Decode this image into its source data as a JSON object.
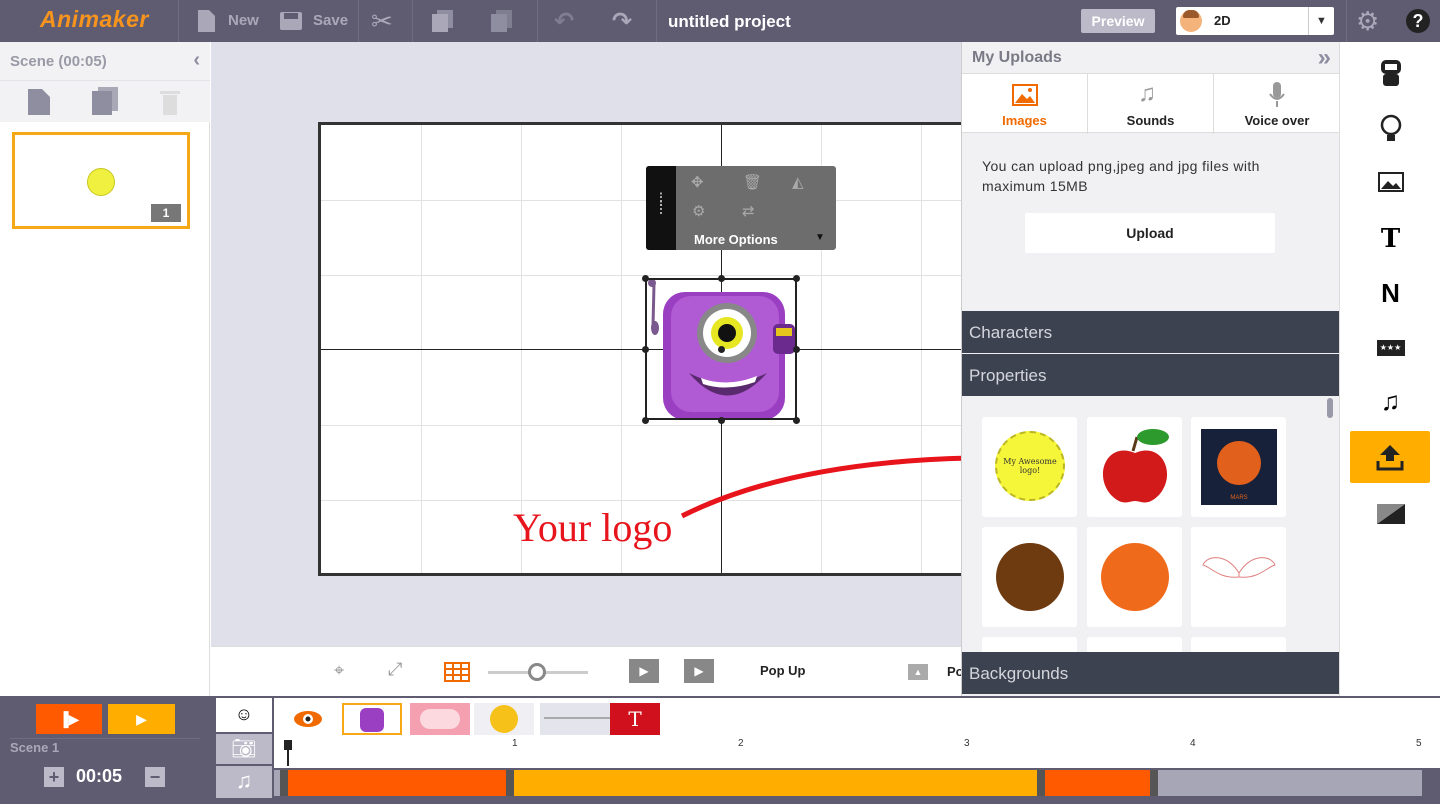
{
  "app": {
    "name": "Animaker",
    "project_title": "untitled project"
  },
  "toolbar": {
    "new_label": "New",
    "save_label": "Save",
    "preview_label": "Preview",
    "mode_value": "2D"
  },
  "scenes": {
    "title": "Scene  (00:05)",
    "thumb_number": "1"
  },
  "canvas": {
    "annotation": "Your logo"
  },
  "object_menu": {
    "more_label": "More Options"
  },
  "stage_tools": {
    "animation_label": "Pop Up",
    "animation_label2": "Po"
  },
  "panel": {
    "title": "My Uploads",
    "tabs": [
      {
        "label": "Images",
        "icon": "image-icon"
      },
      {
        "label": "Sounds",
        "icon": "music-note-icon"
      },
      {
        "label": "Voice over",
        "icon": "microphone-icon"
      }
    ],
    "info": "You can upload png,jpeg and jpg files with maximum 15MB",
    "upload_label": "Upload",
    "sections": {
      "characters": "Characters",
      "properties": "Properties",
      "backgrounds": "Backgrounds"
    },
    "tiles": [
      {
        "name": "logo-tile",
        "text": "My Awesome logo!"
      },
      {
        "name": "apple-tile"
      },
      {
        "name": "mars-tile",
        "text": "MARS"
      },
      {
        "name": "brown-planet-tile"
      },
      {
        "name": "orange-planet-tile"
      },
      {
        "name": "wings-tile"
      }
    ]
  },
  "rail": {
    "items": [
      "character-icon",
      "bulb-icon",
      "image-icon",
      "text-icon",
      "n-icon",
      "rating-icon",
      "music-icon",
      "upload-icon",
      "background-icon"
    ],
    "active": "upload-icon"
  },
  "timeline": {
    "scene_label": "Scene  1",
    "duration": "00:05",
    "ruler_ticks": [
      "1",
      "2",
      "3",
      "4",
      "5"
    ]
  },
  "colors": {
    "accent": "#ff5a00",
    "accent2": "#ffae00",
    "topbar": "#5f5c72",
    "panel_section": "#3d4250"
  }
}
